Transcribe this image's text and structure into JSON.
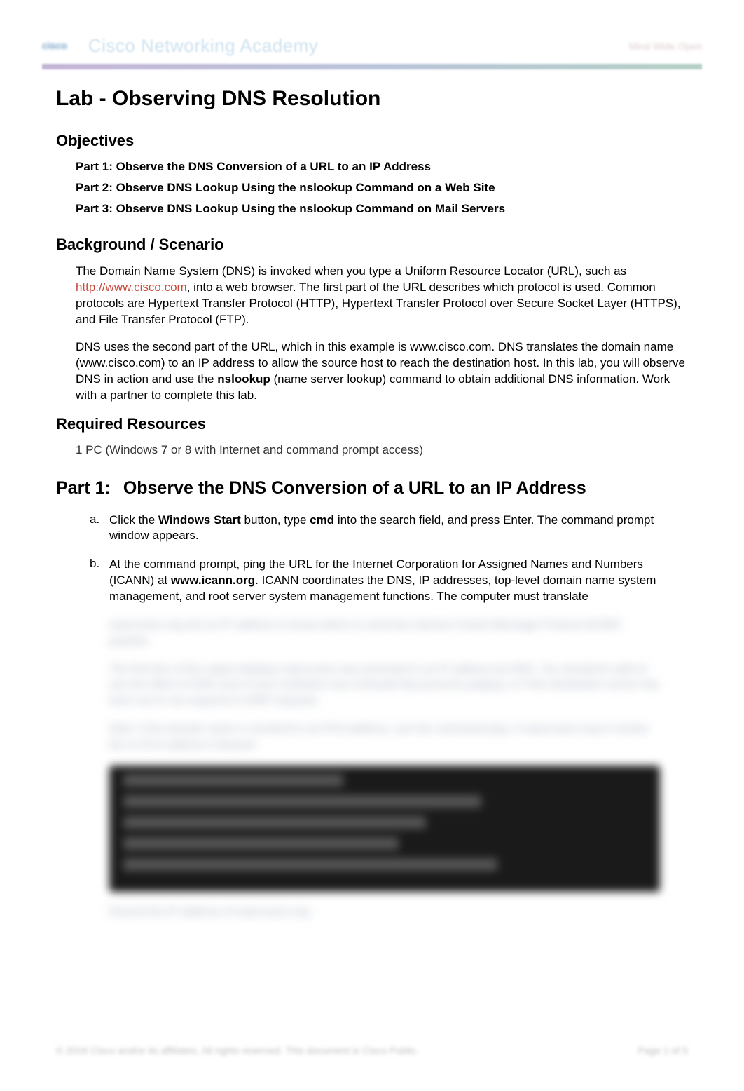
{
  "header": {
    "logo_text": "cisco",
    "academy_title": "Cisco Networking Academy",
    "right_text": "Mind Wide Open"
  },
  "title": "Lab - Observing DNS Resolution",
  "sections": {
    "objectives": {
      "heading": "Objectives",
      "items": [
        "Part 1: Observe the DNS Conversion of a URL to an IP Address",
        "Part 2: Observe DNS Lookup Using the nslookup Command on a Web Site",
        "Part 3: Observe DNS Lookup Using the nslookup Command on Mail Servers"
      ]
    },
    "background": {
      "heading": "Background / Scenario",
      "para1_a": "The Domain Name System (DNS) is invoked when you type a Uniform Resource Locator (URL), such as ",
      "para1_link": "http://www.cisco.com",
      "para1_b": ", into a web browser. The first part of the URL describes which protocol is used. Common protocols are Hypertext Transfer Protocol (HTTP), Hypertext Transfer Protocol over Secure Socket Layer (HTTPS), and File Transfer Protocol (FTP).",
      "para2_a": "DNS uses the second part of the URL, which in this example is www.cisco.com. DNS translates the domain name (www.cisco.com) to an IP address to allow the source host to reach the destination host. In this lab, you will observe DNS in action and use the ",
      "para2_bold": "nslookup",
      "para2_b": " (name server lookup) command to obtain additional DNS information. Work with a partner to complete this lab."
    },
    "resources": {
      "heading": "Required Resources",
      "item": "1 PC (Windows 7 or 8 with Internet and command prompt access)"
    },
    "part1": {
      "prefix": "Part 1:",
      "heading": "Observe the DNS Conversion of a URL to an IP Address",
      "steps": [
        {
          "marker": "a.",
          "pre": "Click the ",
          "bold1": "Windows Start",
          "mid1": " button, type ",
          "bold2": "cmd",
          "post": " into the search field, and press Enter. The command prompt window appears."
        },
        {
          "marker": "b.",
          "pre": "At the command prompt, ping the URL for the Internet Corporation for Assigned Names and Numbers (ICANN) at ",
          "bold1": "www.icann.org",
          "post": ". ICANN coordinates the DNS, IP addresses, top-level domain name system management, and root server system management functions. The computer must translate"
        }
      ]
    }
  },
  "blurred": {
    "line1": "www.icann.org into an IP address to know where to send the Internet Control Message Protocol (ICMP) packets.",
    "line2": "The first line of the output displays www.icann.org converted to an IP address by DNS. You should be able to see the effect of DNS even if your institution has a firewall that prevents pinging, or if the destination server has been set to not respond to ICMP requests.",
    "line3": "Note: If the domain name is resolved to an IPv6 address, use the command ping -4 www.icann.org to resolve the to IPv4 address if desired.",
    "caption": "Record the IP address of www.icann.org."
  },
  "footer": {
    "left": "© 2016 Cisco and/or its affiliates. All rights reserved. This document is Cisco Public.",
    "right": "Page 1 of 5"
  }
}
